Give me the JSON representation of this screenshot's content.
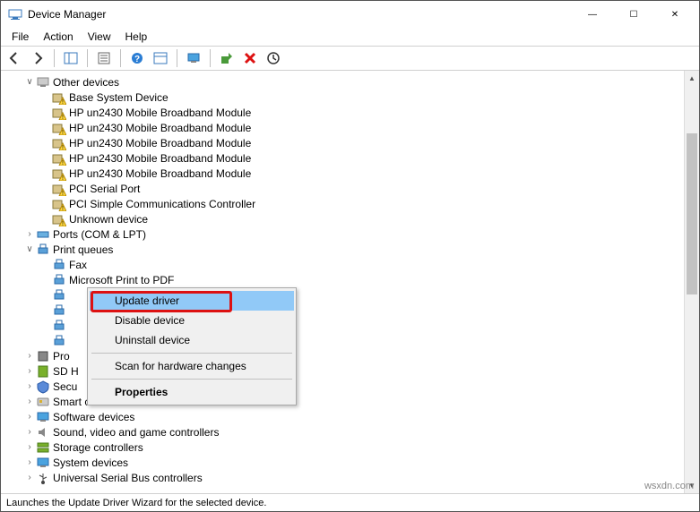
{
  "window": {
    "title": "Device Manager"
  },
  "win_controls": {
    "minimize": "—",
    "maximize": "☐",
    "close": "✕"
  },
  "menu": {
    "file": "File",
    "action": "Action",
    "view": "View",
    "help": "Help"
  },
  "toolbar_icons": {
    "back": "back-arrow",
    "fwd": "forward-arrow",
    "show_panel": "show-panel",
    "properties": "properties",
    "help": "help",
    "detail": "detail-pane",
    "monitor": "monitor",
    "scan": "scan-hardware",
    "uninstall": "uninstall",
    "update": "update-driver"
  },
  "tree": {
    "other_devices": {
      "label": "Other devices",
      "twisty": "v",
      "children": [
        "Base System Device",
        "HP un2430 Mobile Broadband Module",
        "HP un2430 Mobile Broadband Module",
        "HP un2430 Mobile Broadband Module",
        "HP un2430 Mobile Broadband Module",
        "HP un2430 Mobile Broadband Module",
        "PCI Serial Port",
        "PCI Simple Communications Controller",
        "Unknown device"
      ]
    },
    "ports": {
      "label": "Ports (COM & LPT)",
      "twisty": ">"
    },
    "print_queues": {
      "label": "Print queues",
      "twisty": "v",
      "children_visible": [
        "Fax",
        "Microsoft Print to PDF"
      ],
      "children_hidden_count": 4
    },
    "pro": {
      "label": "Pro",
      "twisty": ">"
    },
    "sdh": {
      "label": "SD H",
      "twisty": ">"
    },
    "secu": {
      "label": "Secu",
      "twisty": ">"
    },
    "smart_card": {
      "label": "Smart card readers",
      "twisty": ">"
    },
    "software_devices": {
      "label": "Software devices",
      "twisty": ">"
    },
    "sound_video": {
      "label": "Sound, video and game controllers",
      "twisty": ">"
    },
    "storage_controllers": {
      "label": "Storage controllers",
      "twisty": ">"
    },
    "system_devices": {
      "label": "System devices",
      "twisty": ">"
    },
    "usb": {
      "label": "Universal Serial Bus controllers",
      "twisty": ">"
    }
  },
  "context_menu": {
    "update": "Update driver",
    "disable": "Disable device",
    "uninstall": "Uninstall device",
    "scan": "Scan for hardware changes",
    "properties": "Properties"
  },
  "statusbar": {
    "text": "Launches the Update Driver Wizard for the selected device."
  },
  "watermark": "wsxdn.com"
}
